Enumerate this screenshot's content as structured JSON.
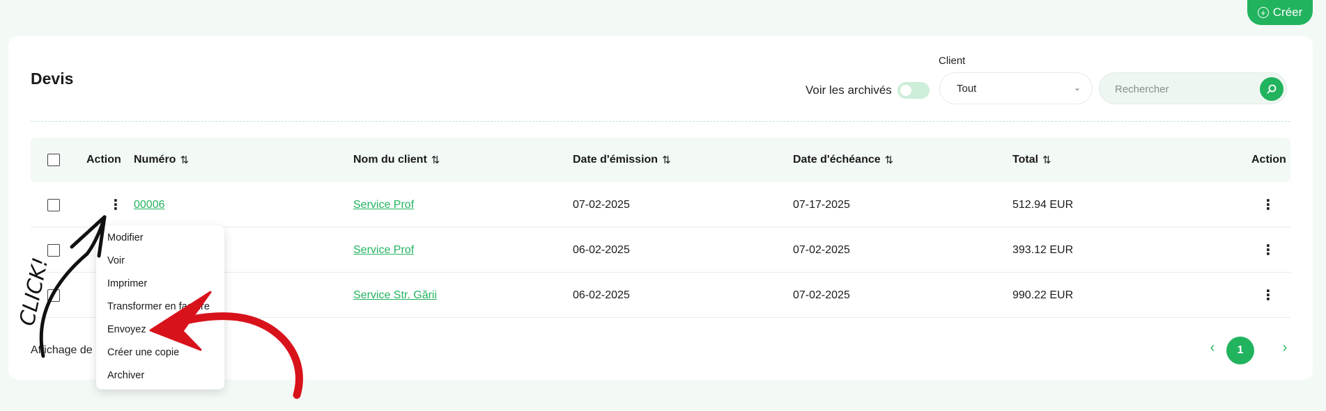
{
  "header": {
    "create_label": "Créer"
  },
  "page": {
    "title": "Devis"
  },
  "filters": {
    "archived_label": "Voir les archivés",
    "client_label": "Client",
    "client_value": "Tout",
    "search_placeholder": "Rechercher"
  },
  "table": {
    "headers": {
      "action_left": "Action",
      "numero": "Numéro",
      "client": "Nom du client",
      "date_emission": "Date d'émission",
      "date_echeance": "Date d'échéance",
      "total": "Total",
      "action_right": "Action"
    },
    "sort_glyph": "⇅",
    "rows": [
      {
        "numero": "00006",
        "client": "Service Prof",
        "date_emission": "07-02-2025",
        "date_echeance": "07-17-2025",
        "total": "512.94 EUR"
      },
      {
        "numero": "",
        "client": "Service Prof",
        "date_emission": "06-02-2025",
        "date_echeance": "07-02-2025",
        "total": "393.12 EUR"
      },
      {
        "numero": "",
        "client": "Service Str. Gării",
        "date_emission": "06-02-2025",
        "date_echeance": "07-02-2025",
        "total": "990.22 EUR"
      }
    ]
  },
  "dropdown": {
    "items": [
      "Modifier",
      "Voir",
      "Imprimer",
      "Transformer en facture",
      "Envoyez",
      "Créer une copie",
      "Archiver"
    ]
  },
  "footer": {
    "showing_text": "Affichage de"
  },
  "pagination": {
    "current_page": "1"
  },
  "annotation": {
    "text": "CLICK!"
  },
  "colors": {
    "accent": "#22b35e",
    "background": "#f3f9f5",
    "annotation_red": "#d8121b"
  }
}
